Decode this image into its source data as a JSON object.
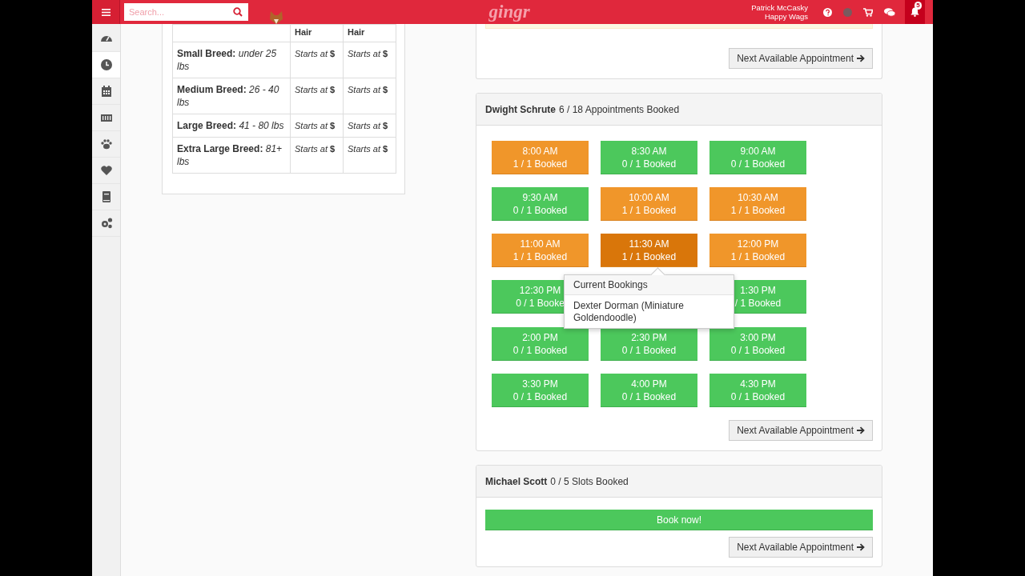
{
  "top_bar": {
    "search": {
      "placeholder": "Search..."
    },
    "logo": "gingr",
    "user": {
      "name": "Patrick McCasky",
      "business": "Happy Wags"
    },
    "notifications": "5"
  },
  "sidebar": {
    "items": [
      {
        "kind": "dashboard",
        "selected": false
      },
      {
        "kind": "clock",
        "selected": true
      },
      {
        "kind": "calendar",
        "selected": false
      },
      {
        "kind": "barcode",
        "selected": false
      },
      {
        "kind": "paw",
        "selected": false
      },
      {
        "kind": "heart",
        "selected": false
      },
      {
        "kind": "book",
        "selected": false
      },
      {
        "kind": "gears",
        "selected": false
      }
    ]
  },
  "pricing_table": {
    "header": [
      "Hair",
      "Hair"
    ],
    "rows": [
      {
        "label": "Small Breed:",
        "detail": "under 25 lbs",
        "cells": [
          "*Starts at* **$**",
          "*Starts at* **$**"
        ]
      },
      {
        "label": "Medium Breed:",
        "detail": "26 - 40 lbs",
        "cells": [
          "*Starts at* **$**",
          "*Starts at* **$**"
        ]
      },
      {
        "label": "Large Breed:",
        "detail": "41 - 80 lbs",
        "cells": [
          "*Starts at* **$**",
          "*Starts at* **$**"
        ]
      },
      {
        "label": "Extra Large Breed:",
        "detail": "81+ lbs",
        "cells": [
          "*Starts at* **$**",
          "*Starts at* **$**"
        ]
      }
    ]
  },
  "top_panel": {
    "button": "Next Available Appointment"
  },
  "groomers": [
    {
      "name": "Dwight Schrute",
      "summary": "6 / 18 Appointments Booked",
      "slots": [
        {
          "time": "8:00 AM",
          "booked": "1 / 1 Booked",
          "kind": "booked",
          "hovered": false
        },
        {
          "time": "8:30 AM",
          "booked": "0 / 1 Booked",
          "kind": "open",
          "hovered": false
        },
        {
          "time": "9:00 AM",
          "booked": "0 / 1 Booked",
          "kind": "open",
          "hovered": false
        },
        {
          "time": "9:30 AM",
          "booked": "0 / 1 Booked",
          "kind": "open",
          "hovered": false
        },
        {
          "time": "10:00 AM",
          "booked": "1 / 1 Booked",
          "kind": "booked",
          "hovered": false
        },
        {
          "time": "10:30 AM",
          "booked": "1 / 1 Booked",
          "kind": "booked",
          "hovered": false
        },
        {
          "time": "11:00 AM",
          "booked": "1 / 1 Booked",
          "kind": "booked",
          "hovered": false
        },
        {
          "time": "11:30 AM",
          "booked": "1 / 1 Booked",
          "kind": "booked",
          "hovered": true
        },
        {
          "time": "12:00 PM",
          "booked": "1 / 1 Booked",
          "kind": "booked",
          "hovered": false
        },
        {
          "time": "12:30 PM",
          "booked": "0 / 1 Booke",
          "kind": "open",
          "hovered": false
        },
        {
          "kind": "open"
        },
        {
          "time": "1:30 PM",
          "booked": "/ 1 Booked",
          "kind": "open",
          "hovered": false
        },
        {
          "time": "2:00 PM",
          "booked": "0 / 1 Booked",
          "kind": "open",
          "hovered": false
        },
        {
          "time": "2:30 PM",
          "booked": "0 / 1 Booked",
          "kind": "open",
          "hovered": false
        },
        {
          "time": "3:00 PM",
          "booked": "0 / 1 Booked",
          "kind": "open",
          "hovered": false
        },
        {
          "time": "3:30 PM",
          "booked": "0 / 1 Booked",
          "kind": "open",
          "hovered": false
        },
        {
          "time": "4:00 PM",
          "booked": "0 / 1 Booked",
          "kind": "open",
          "hovered": false
        },
        {
          "time": "4:30 PM",
          "booked": "0 / 1 Booked",
          "kind": "open",
          "hovered": false
        }
      ],
      "popover": {
        "title": "Current Bookings",
        "entries": [
          "Dexter Dorman (Miniature Goldendoodle)"
        ]
      },
      "button": "Next Available Appointment"
    },
    {
      "name": "Michael Scott",
      "summary": "0 / 5 Slots Booked",
      "book_button": "Book now!",
      "button": "Next Available Appointment"
    }
  ]
}
